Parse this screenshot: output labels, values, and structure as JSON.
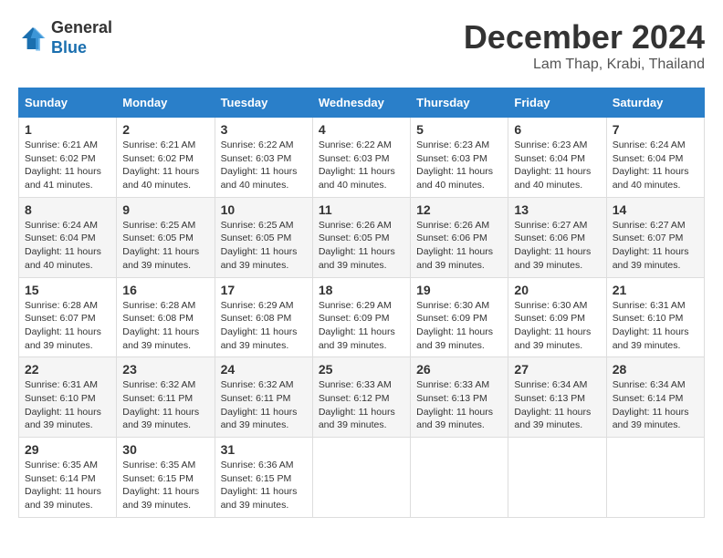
{
  "header": {
    "logo_general": "General",
    "logo_blue": "Blue",
    "month_title": "December 2024",
    "location": "Lam Thap, Krabi, Thailand"
  },
  "calendar": {
    "headers": [
      "Sunday",
      "Monday",
      "Tuesday",
      "Wednesday",
      "Thursday",
      "Friday",
      "Saturday"
    ],
    "weeks": [
      [
        null,
        {
          "day": "2",
          "sunrise": "6:21 AM",
          "sunset": "6:02 PM",
          "daylight": "11 hours and 40 minutes."
        },
        {
          "day": "3",
          "sunrise": "6:22 AM",
          "sunset": "6:03 PM",
          "daylight": "11 hours and 40 minutes."
        },
        {
          "day": "4",
          "sunrise": "6:22 AM",
          "sunset": "6:03 PM",
          "daylight": "11 hours and 40 minutes."
        },
        {
          "day": "5",
          "sunrise": "6:23 AM",
          "sunset": "6:03 PM",
          "daylight": "11 hours and 40 minutes."
        },
        {
          "day": "6",
          "sunrise": "6:23 AM",
          "sunset": "6:04 PM",
          "daylight": "11 hours and 40 minutes."
        },
        {
          "day": "7",
          "sunrise": "6:24 AM",
          "sunset": "6:04 PM",
          "daylight": "11 hours and 40 minutes."
        }
      ],
      [
        {
          "day": "1",
          "sunrise": "6:21 AM",
          "sunset": "6:02 PM",
          "daylight": "11 hours and 41 minutes."
        },
        {
          "day": "8",
          "sunrise": "6:24 AM",
          "sunset": "6:04 PM",
          "daylight": "11 hours and 40 minutes."
        },
        {
          "day": "9",
          "sunrise": "6:25 AM",
          "sunset": "6:05 PM",
          "daylight": "11 hours and 39 minutes."
        },
        {
          "day": "10",
          "sunrise": "6:25 AM",
          "sunset": "6:05 PM",
          "daylight": "11 hours and 39 minutes."
        },
        {
          "day": "11",
          "sunrise": "6:26 AM",
          "sunset": "6:05 PM",
          "daylight": "11 hours and 39 minutes."
        },
        {
          "day": "12",
          "sunrise": "6:26 AM",
          "sunset": "6:06 PM",
          "daylight": "11 hours and 39 minutes."
        },
        {
          "day": "13",
          "sunrise": "6:27 AM",
          "sunset": "6:06 PM",
          "daylight": "11 hours and 39 minutes."
        },
        {
          "day": "14",
          "sunrise": "6:27 AM",
          "sunset": "6:07 PM",
          "daylight": "11 hours and 39 minutes."
        }
      ],
      [
        {
          "day": "15",
          "sunrise": "6:28 AM",
          "sunset": "6:07 PM",
          "daylight": "11 hours and 39 minutes."
        },
        {
          "day": "16",
          "sunrise": "6:28 AM",
          "sunset": "6:08 PM",
          "daylight": "11 hours and 39 minutes."
        },
        {
          "day": "17",
          "sunrise": "6:29 AM",
          "sunset": "6:08 PM",
          "daylight": "11 hours and 39 minutes."
        },
        {
          "day": "18",
          "sunrise": "6:29 AM",
          "sunset": "6:09 PM",
          "daylight": "11 hours and 39 minutes."
        },
        {
          "day": "19",
          "sunrise": "6:30 AM",
          "sunset": "6:09 PM",
          "daylight": "11 hours and 39 minutes."
        },
        {
          "day": "20",
          "sunrise": "6:30 AM",
          "sunset": "6:09 PM",
          "daylight": "11 hours and 39 minutes."
        },
        {
          "day": "21",
          "sunrise": "6:31 AM",
          "sunset": "6:10 PM",
          "daylight": "11 hours and 39 minutes."
        }
      ],
      [
        {
          "day": "22",
          "sunrise": "6:31 AM",
          "sunset": "6:10 PM",
          "daylight": "11 hours and 39 minutes."
        },
        {
          "day": "23",
          "sunrise": "6:32 AM",
          "sunset": "6:11 PM",
          "daylight": "11 hours and 39 minutes."
        },
        {
          "day": "24",
          "sunrise": "6:32 AM",
          "sunset": "6:11 PM",
          "daylight": "11 hours and 39 minutes."
        },
        {
          "day": "25",
          "sunrise": "6:33 AM",
          "sunset": "6:12 PM",
          "daylight": "11 hours and 39 minutes."
        },
        {
          "day": "26",
          "sunrise": "6:33 AM",
          "sunset": "6:13 PM",
          "daylight": "11 hours and 39 minutes."
        },
        {
          "day": "27",
          "sunrise": "6:34 AM",
          "sunset": "6:13 PM",
          "daylight": "11 hours and 39 minutes."
        },
        {
          "day": "28",
          "sunrise": "6:34 AM",
          "sunset": "6:14 PM",
          "daylight": "11 hours and 39 minutes."
        }
      ],
      [
        {
          "day": "29",
          "sunrise": "6:35 AM",
          "sunset": "6:14 PM",
          "daylight": "11 hours and 39 minutes."
        },
        {
          "day": "30",
          "sunrise": "6:35 AM",
          "sunset": "6:15 PM",
          "daylight": "11 hours and 39 minutes."
        },
        {
          "day": "31",
          "sunrise": "6:36 AM",
          "sunset": "6:15 PM",
          "daylight": "11 hours and 39 minutes."
        },
        null,
        null,
        null,
        null
      ]
    ]
  }
}
